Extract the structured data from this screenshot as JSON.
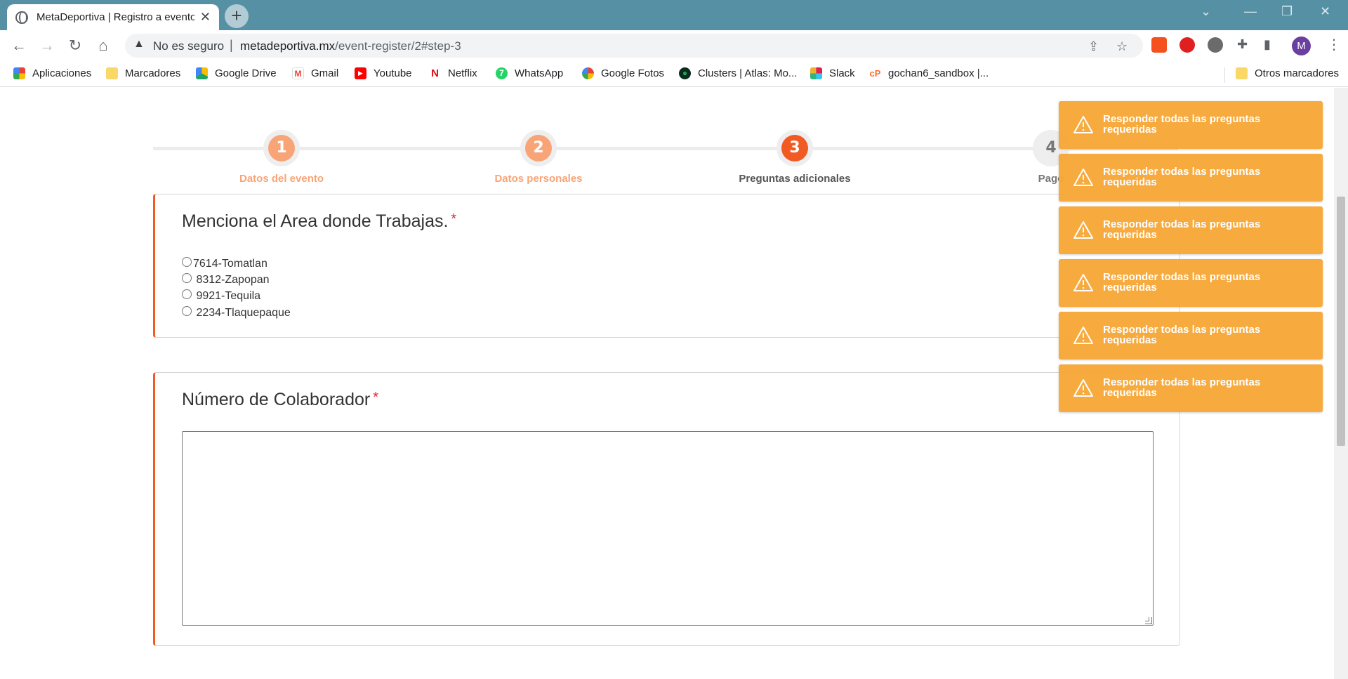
{
  "browser": {
    "tab_title": "MetaDeportiva | Registro a evento",
    "new_tab": "+",
    "security_label": "No es seguro",
    "url_domain": "metadeportiva.mx",
    "url_path": "/event-register/2#step-3",
    "profile_initial": "M"
  },
  "bookmarks": [
    {
      "label": "Aplicaciones",
      "icon": "apps-grid-icon",
      "color": "#ea4335"
    },
    {
      "label": "Marcadores",
      "icon": "folder-icon",
      "color": "#f9d866"
    },
    {
      "label": "Google Drive",
      "icon": "google-drive-icon",
      "color": "#1fa463"
    },
    {
      "label": "Gmail",
      "icon": "gmail-icon",
      "color": "#ea4335"
    },
    {
      "label": "Youtube",
      "icon": "youtube-icon",
      "color": "#ff0000"
    },
    {
      "label": "Netflix",
      "icon": "netflix-icon",
      "color": "#e50914"
    },
    {
      "label": "WhatsApp",
      "icon": "whatsapp-icon",
      "color": "#25d366"
    },
    {
      "label": "Google Fotos",
      "icon": "google-photos-icon",
      "color": "#fbbc04"
    },
    {
      "label": "Clusters | Atlas: Mo...",
      "icon": "mongodb-icon",
      "color": "#13aa52"
    },
    {
      "label": "Slack",
      "icon": "slack-icon",
      "color": "#e01e5a"
    },
    {
      "label": "gochan6_sandbox |...",
      "icon": "cpanel-icon",
      "color": "#ff6c2c"
    }
  ],
  "other_bookmarks": "Otros marcadores",
  "steps": [
    {
      "number": "1",
      "label": "Datos del evento",
      "state": "done"
    },
    {
      "number": "2",
      "label": "Datos personales",
      "state": "done"
    },
    {
      "number": "3",
      "label": "Preguntas adicionales",
      "state": "active"
    },
    {
      "number": "4",
      "label": "Pago",
      "state": "pending"
    }
  ],
  "question1": {
    "title": "Menciona el Area donde Trabajas.",
    "required_mark": "*",
    "options": [
      "7614-Tomatlan",
      " 8312-Zapopan",
      " 9921-Tequila",
      " 2234-Tlaquepaque"
    ]
  },
  "question2": {
    "title": "Número de Colaborador",
    "required_mark": "*",
    "value": ""
  },
  "toasts": [
    "Responder todas las preguntas requeridas",
    "Responder todas las preguntas requeridas",
    "Responder todas las preguntas requeridas",
    "Responder todas las preguntas requeridas",
    "Responder todas las preguntas requeridas",
    "Responder todas las preguntas requeridas"
  ],
  "colors": {
    "accent": "#f15a22",
    "step_done": "#f8a477",
    "step_active": "#f15a22",
    "toast_bg": "#f7a737"
  }
}
